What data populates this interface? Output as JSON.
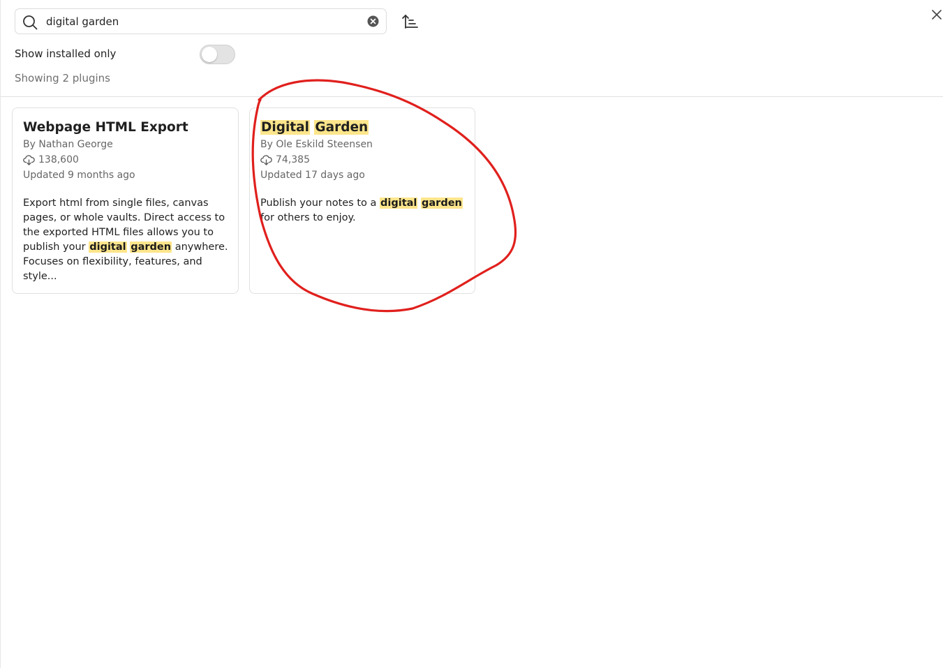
{
  "search": {
    "value": "digital garden",
    "icon": "search-icon",
    "clear_icon": "clear-circle-icon"
  },
  "toolbar": {
    "sort_icon": "sort-ascending-icon",
    "close_icon": "close-icon"
  },
  "filter": {
    "installed_label": "Show installed only",
    "installed_on": false
  },
  "result_count": "Showing 2 plugins",
  "highlight_color": "#fde58b",
  "annotation_color": "#e0201d",
  "plugins": [
    {
      "title": "Webpage HTML Export",
      "author": "By Nathan George",
      "downloads": "138,600",
      "updated": "Updated 9 months ago",
      "description": {
        "before": "Export html from single files, canvas pages, or whole vaults. Direct access to the exported HTML files allows you to publish your",
        "hl_1": "digital",
        "hl_2": "garden",
        "after": "anywhere. Focuses on flexibility, features, and style..."
      }
    },
    {
      "title_hl_1": "Digital",
      "title_hl_2": "Garden",
      "author": "By Ole Eskild Steensen",
      "downloads": "74,385",
      "updated": "Updated 17 days ago",
      "description": {
        "before": "Publish your notes to a",
        "hl_1": "digital",
        "hl_2": "garden",
        "after": "for others to enjoy."
      }
    }
  ]
}
